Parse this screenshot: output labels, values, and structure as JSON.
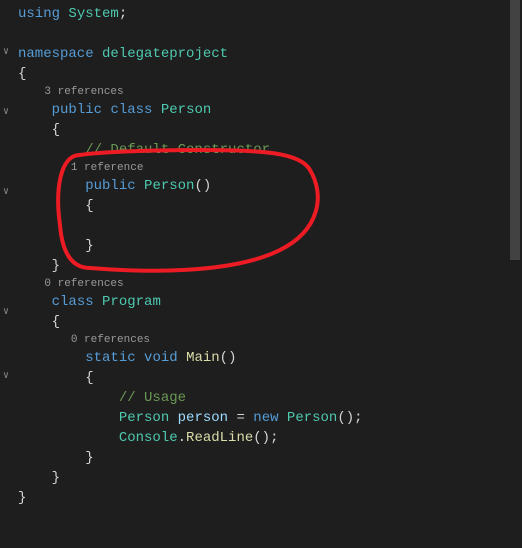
{
  "code": {
    "l1_using": "using",
    "l1_system": "System",
    "l1_semi": ";",
    "l3_namespace": "namespace",
    "l3_name": "delegateproject",
    "brace_open": "{",
    "brace_close": "}",
    "ref3": "3 references",
    "ref1": "1 reference",
    "ref0a": "0 references",
    "ref0b": "0 references",
    "kw_public": "public",
    "kw_class": "class",
    "kw_static": "static",
    "kw_void": "void",
    "kw_new": "new",
    "cls_person": "Person",
    "cls_program": "Program",
    "cls_console": "Console",
    "fn_person": "Person",
    "fn_main": "Main",
    "fn_readline": "ReadLine",
    "var_person": "person",
    "comment_ctor": "// Default Constructor",
    "comment_usage": "// Usage",
    "paren_pair": "()",
    "paren_semi": "();",
    "eq": " = "
  },
  "folds": [
    "∨",
    "∨",
    "∨",
    "∨",
    "∨"
  ],
  "annotation_color": "#ed1c24"
}
